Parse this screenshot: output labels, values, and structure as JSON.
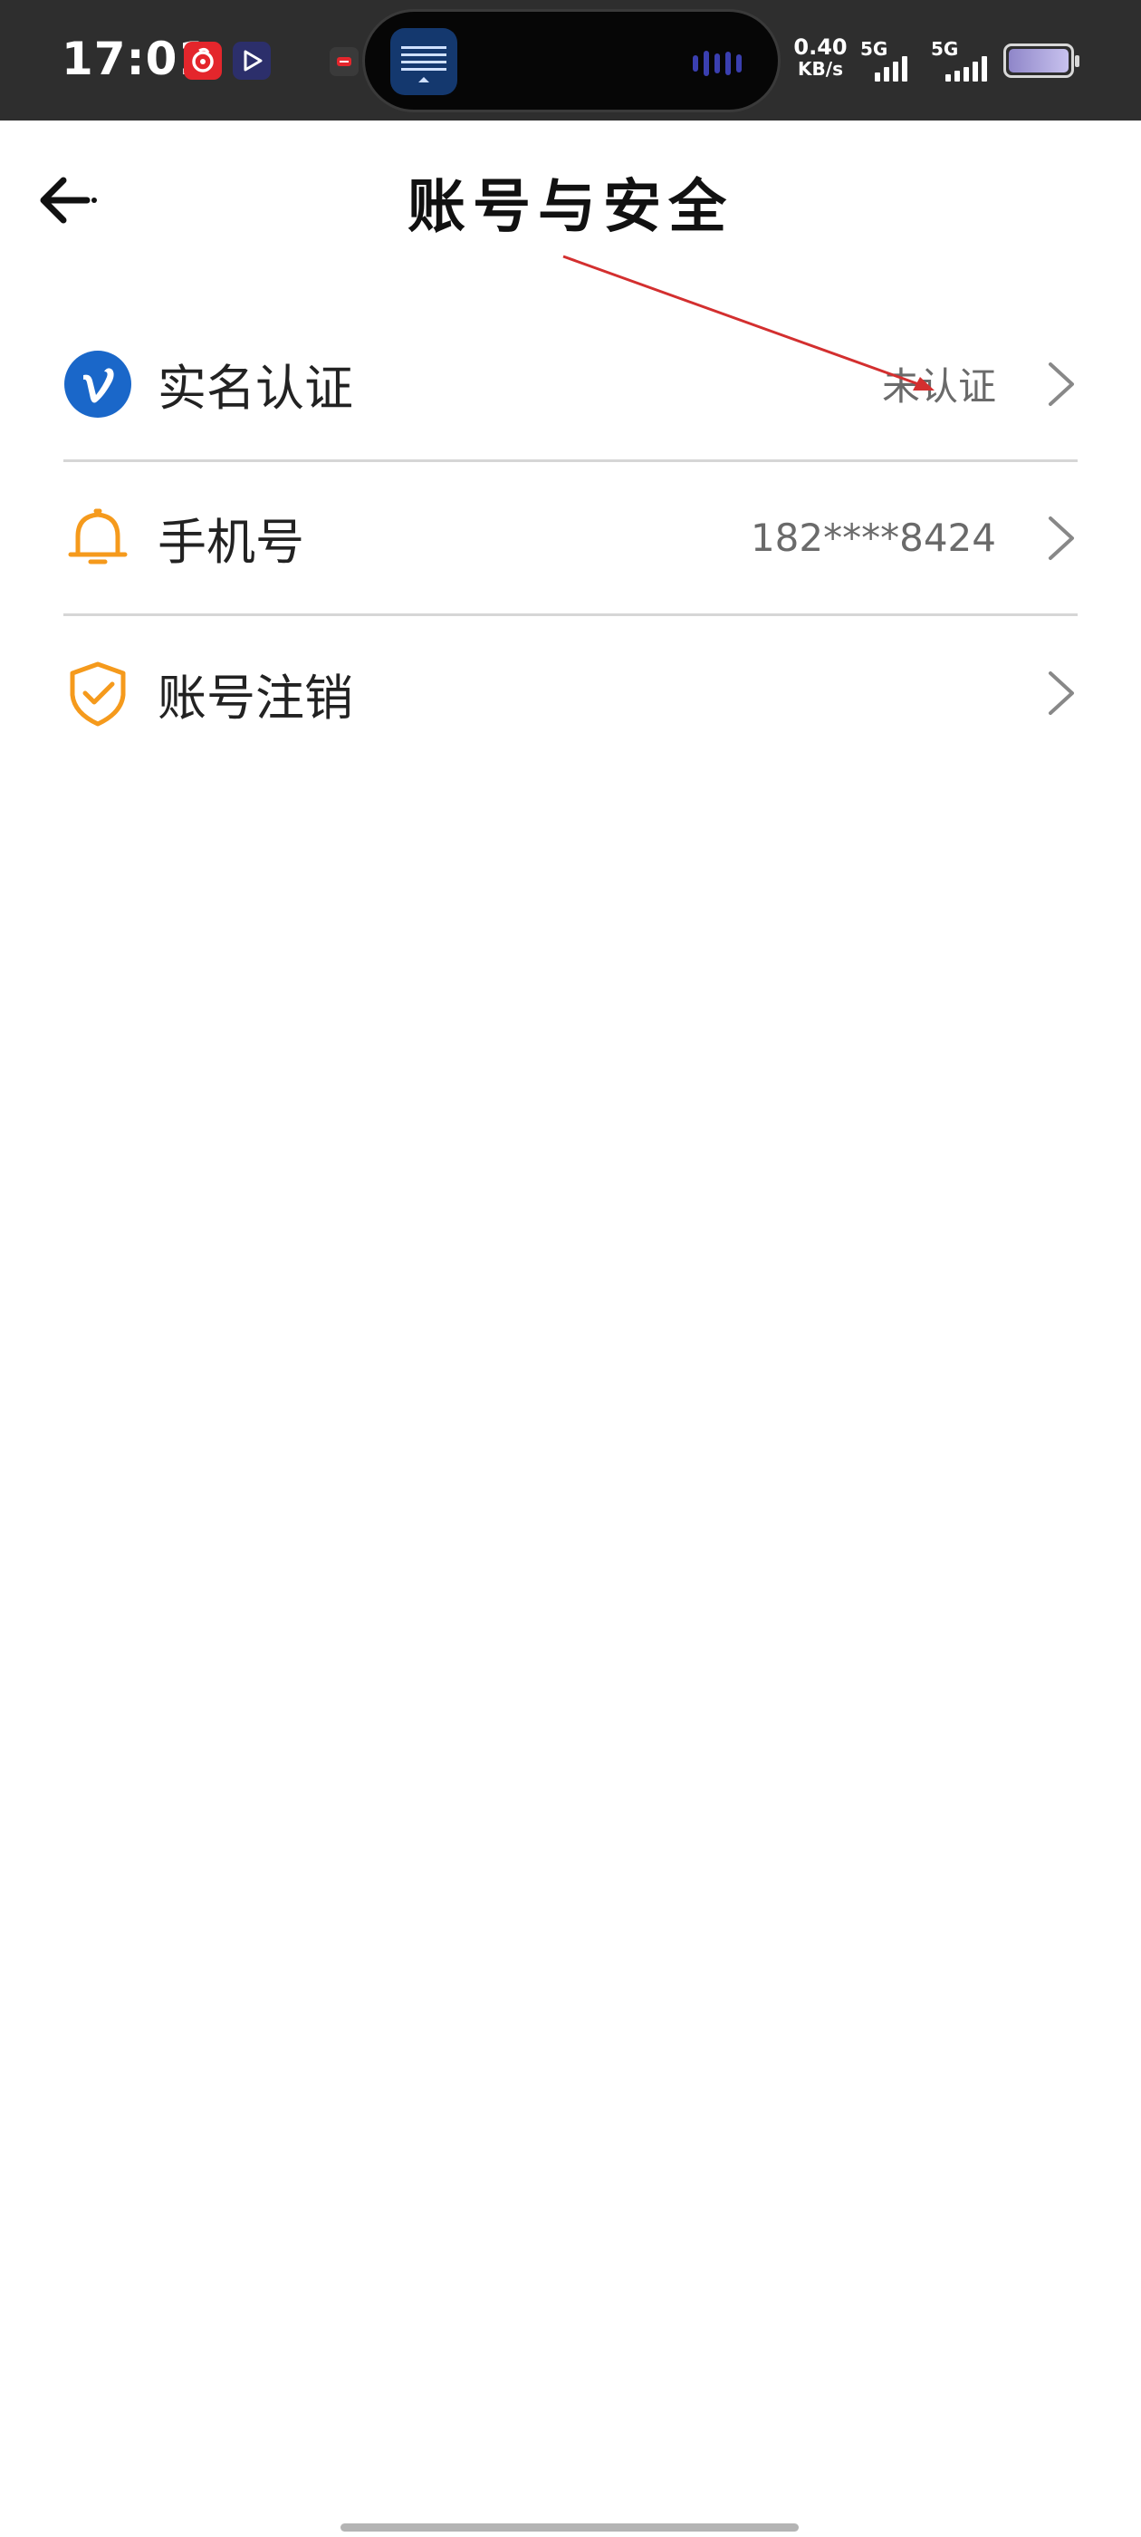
{
  "status_bar": {
    "time": "17:01",
    "net_speed_value": "0.40",
    "net_speed_unit": "KB/s",
    "signal_1_label": "5G",
    "signal_2_label": "5G",
    "icons": [
      "netease-music-icon",
      "video-app-icon",
      "notification-icon",
      "keyboard-app-icon",
      "audio-wave-icon",
      "battery-icon"
    ]
  },
  "header": {
    "title": "账号与安全",
    "back_icon": "arrow-left-icon"
  },
  "settings": {
    "items": [
      {
        "label": "实名认证",
        "value": "未认证",
        "icon": "verified-v-icon",
        "icon_color": "#1a67c9"
      },
      {
        "label": "手机号",
        "value": "182****8424",
        "icon": "bell-icon",
        "icon_color": "#f59a1c"
      },
      {
        "label": "账号注销",
        "value": "",
        "icon": "shield-check-icon",
        "icon_color": "#f59a1c"
      }
    ]
  },
  "colors": {
    "status_bar_bg": "#2e2e2e",
    "divider": "#d6d6d6",
    "annotation_arrow": "#d32f2f"
  }
}
